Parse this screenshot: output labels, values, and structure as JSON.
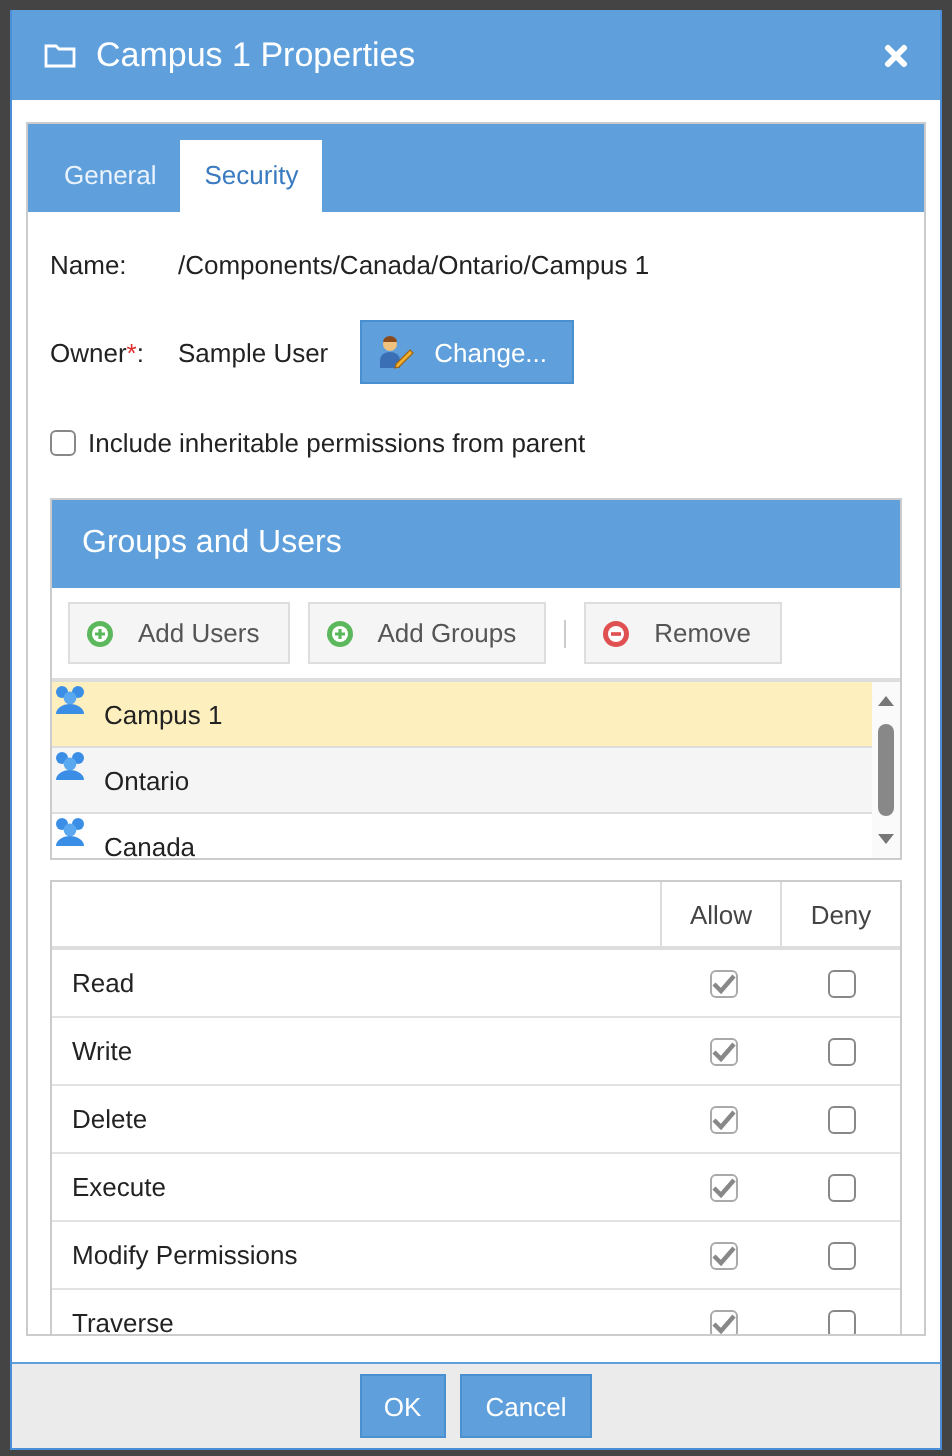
{
  "window": {
    "title": "Campus 1 Properties"
  },
  "tabs": [
    {
      "label": "General",
      "selected": false
    },
    {
      "label": "Security",
      "selected": true
    }
  ],
  "name": {
    "label": "Name:",
    "value": "/Components/Canada/Ontario/Campus 1"
  },
  "owner": {
    "label": "Owner",
    "required_mark": "*",
    "colon": ":",
    "value": "Sample User",
    "button": "Change..."
  },
  "inherit": {
    "label": "Include inheritable permissions from parent",
    "checked": false
  },
  "groups": {
    "title": "Groups and Users",
    "toolbar": [
      {
        "label": "Add Users",
        "kind": "add"
      },
      {
        "label": "Add Groups",
        "kind": "add"
      },
      {
        "label": "Remove",
        "kind": "remove"
      }
    ],
    "items": [
      {
        "name": "Campus 1",
        "selected": true
      },
      {
        "name": "Ontario",
        "selected": false
      },
      {
        "name": "Canada",
        "selected": false
      }
    ]
  },
  "permissions": {
    "columns": [
      "Allow",
      "Deny"
    ],
    "rows": [
      {
        "name": "Read",
        "allow": true,
        "deny": false
      },
      {
        "name": "Write",
        "allow": true,
        "deny": false
      },
      {
        "name": "Delete",
        "allow": true,
        "deny": false
      },
      {
        "name": "Execute",
        "allow": true,
        "deny": false
      },
      {
        "name": "Modify Permissions",
        "allow": true,
        "deny": false
      },
      {
        "name": "Traverse",
        "allow": true,
        "deny": false
      }
    ]
  },
  "buttons": [
    "OK",
    "Cancel"
  ]
}
